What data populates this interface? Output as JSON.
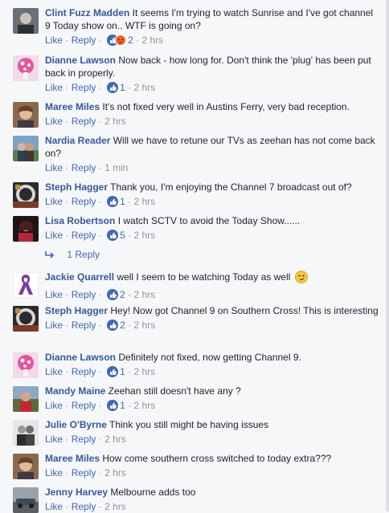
{
  "actions": {
    "like": "Like",
    "reply": "Reply",
    "sep": "·"
  },
  "comments": [
    {
      "name": "Clint Fuzz Madden",
      "text": "It seems I'm trying to watch Sunrise and I've got channel 9 Today show on.. WTF is going on?",
      "reactions": "like-angry",
      "count": "2",
      "time": "2 hrs",
      "avatar": "portrait-dark"
    },
    {
      "name": "Dianne Lawson",
      "text": "Now back - how long for. Don't think the 'plug' has been put back in properly.",
      "reactions": "like",
      "count": "1",
      "time": "2 hrs",
      "avatar": "pink-mushroom"
    },
    {
      "name": "Maree Miles",
      "text": "It's not fixed very well in Austins Ferry, very bad reception.",
      "reactions": "",
      "count": "",
      "time": "2 hrs",
      "avatar": "portrait-warm"
    },
    {
      "name": "Nardia Reader",
      "text": "Will we have to retune our TVs as zeehan has not come back on?",
      "reactions": "",
      "count": "",
      "time": "1 min",
      "avatar": "couple-outdoor"
    },
    {
      "name": "Steph Hagger",
      "text": "Thank you, I'm enjoying the Channel 7 broadcast out of?",
      "reactions": "like",
      "count": "1",
      "time": "2 hrs",
      "avatar": "dark-ring"
    },
    {
      "name": "Lisa Robertson",
      "text": "I watch SCTV to avoid the Today Show......",
      "reactions": "like",
      "count": "5",
      "time": "2 hrs",
      "avatar": "portrait-red"
    },
    {
      "name": "Jackie Quarrell",
      "text": "well I seem to be watching Today as well",
      "reactions": "like",
      "count": "2",
      "time": "2 hrs",
      "avatar": "purple-ribbon"
    },
    {
      "name": "Steph Hagger",
      "text": "Hey! Now got Channel 9 on Southern Cross! This is interesting",
      "reactions": "like",
      "count": "2",
      "time": "2 hrs",
      "avatar": "dark-ring"
    },
    {
      "name": "Dianne Lawson",
      "text": "Definitely not fixed, now getting Channel 9.",
      "reactions": "like",
      "count": "1",
      "time": "2 hrs",
      "avatar": "pink-mushroom"
    },
    {
      "name": "Mandy Maine",
      "text": "Zeehan still doesn't have any ?",
      "reactions": "like",
      "count": "1",
      "time": "2 hrs",
      "avatar": "red-outdoor"
    },
    {
      "name": "Julie O'Byrne",
      "text": "Think you still might be having issues",
      "reactions": "",
      "count": "",
      "time": "2 hrs",
      "avatar": "bw-couple"
    },
    {
      "name": "Maree Miles",
      "text": "How come southern cross switched to today extra???",
      "reactions": "",
      "count": "",
      "time": "2 hrs",
      "avatar": "portrait-warm"
    },
    {
      "name": "Jenny Harvey",
      "text": "Melbourne adds too",
      "reactions": "",
      "count": "",
      "time": "2 hrs",
      "avatar": "car-street"
    }
  ],
  "replies_link": {
    "label": "1 Reply"
  },
  "colors": {
    "name": "#365899",
    "link": "#4267b2",
    "meta": "#90949c",
    "like": "#4267b2",
    "angry": "#f0612d"
  }
}
